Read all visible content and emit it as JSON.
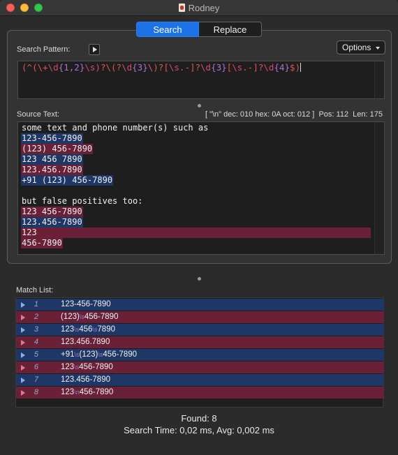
{
  "window": {
    "title": "Rodney"
  },
  "tabs": [
    {
      "label": "Search",
      "active": true
    },
    {
      "label": "Replace",
      "active": false
    }
  ],
  "search_pattern": {
    "label": "Search Pattern:",
    "options_label": "Options",
    "pattern": "(^(\\+\\d{1,2}\\s)?\\(?\\d{3}\\)?[\\s.-]?\\d{3}[\\s.-]?\\d{4}$)"
  },
  "source": {
    "label": "Source Text:",
    "status": "[ \"\\n\" dec: 010 hex: 0A oct: 012 ]  Pos: 112  Len: 175",
    "lines": [
      {
        "text": "some text and phone number(s) such as",
        "hl": "none"
      },
      {
        "text": "123-456-7890",
        "hl": "blue"
      },
      {
        "text": "(123) 456-7890",
        "hl": "red"
      },
      {
        "text": "123 456 7890",
        "hl": "blue"
      },
      {
        "text": "123.456.7890",
        "hl": "red"
      },
      {
        "text": "+91 (123) 456-7890",
        "hl": "blue"
      },
      {
        "text": "",
        "hl": "none"
      },
      {
        "text": "but false positives too:",
        "hl": "none"
      },
      {
        "text": "123 456-7890",
        "hl": "red"
      },
      {
        "text": "123.456-7890",
        "hl": "blue"
      },
      {
        "text": "123",
        "hl": "red-full"
      },
      {
        "text": "456-7890",
        "hl": "red"
      }
    ]
  },
  "match_list": {
    "label": "Match List:",
    "items": [
      {
        "num": "1",
        "parts": [
          "123-456-7890"
        ]
      },
      {
        "num": "2",
        "parts": [
          "(123)",
          "\\s",
          "456-7890"
        ]
      },
      {
        "num": "3",
        "parts": [
          "123",
          "\\s",
          "456",
          "\\s",
          "7890"
        ]
      },
      {
        "num": "4",
        "parts": [
          "123.456.7890"
        ]
      },
      {
        "num": "5",
        "parts": [
          "+91",
          "\\s",
          "(123)",
          "\\s",
          "456-7890"
        ]
      },
      {
        "num": "6",
        "parts": [
          "123",
          "\\s",
          "456-7890"
        ]
      },
      {
        "num": "7",
        "parts": [
          "123.456-7890"
        ]
      },
      {
        "num": "8",
        "parts": [
          "123",
          "\\n",
          "456-7890"
        ]
      }
    ]
  },
  "summary": {
    "found": "Found: 8",
    "timing": "Search Time: 0,02 ms, Avg: 0,002 ms"
  },
  "colors": {
    "accent": "#1c72e6",
    "match_blue": "#1e3766",
    "match_red": "#6a2036",
    "escape": "#b26fd2"
  }
}
